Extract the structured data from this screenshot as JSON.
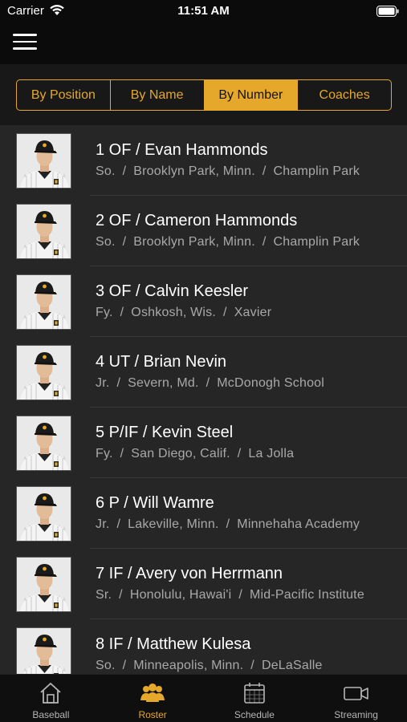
{
  "status_bar": {
    "carrier": "Carrier",
    "time": "11:51 AM"
  },
  "segments": [
    {
      "label": "By Position",
      "active": false
    },
    {
      "label": "By Name",
      "active": false
    },
    {
      "label": "By Number",
      "active": true
    },
    {
      "label": "Coaches",
      "active": false
    }
  ],
  "players": [
    {
      "title": "1 OF / Evan Hammonds",
      "year": "So.",
      "hometown": "Brooklyn Park, Minn.",
      "school": "Champlin Park"
    },
    {
      "title": "2 OF / Cameron Hammonds",
      "year": "So.",
      "hometown": "Brooklyn Park, Minn.",
      "school": "Champlin Park"
    },
    {
      "title": "3 OF / Calvin Keesler",
      "year": "Fy.",
      "hometown": "Oshkosh, Wis.",
      "school": "Xavier"
    },
    {
      "title": "4 UT / Brian Nevin",
      "year": "Jr.",
      "hometown": "Severn, Md.",
      "school": "McDonogh School"
    },
    {
      "title": "5 P/IF / Kevin Steel",
      "year": "Fy.",
      "hometown": "San Diego, Calif.",
      "school": "La Jolla"
    },
    {
      "title": "6 P / Will Wamre",
      "year": "Jr.",
      "hometown": "Lakeville, Minn.",
      "school": "Minnehaha Academy"
    },
    {
      "title": "7 IF / Avery von Herrmann",
      "year": "Sr.",
      "hometown": "Honolulu, Hawai'i",
      "school": "Mid-Pacific Institute"
    },
    {
      "title": "8 IF / Matthew Kulesa",
      "year": "So.",
      "hometown": "Minneapolis, Minn.",
      "school": "DeLaSalle"
    }
  ],
  "separator": "/",
  "tabs": [
    {
      "label": "Baseball",
      "icon": "home-icon",
      "active": false
    },
    {
      "label": "Roster",
      "icon": "people-icon",
      "active": true
    },
    {
      "label": "Schedule",
      "icon": "calendar-icon",
      "active": false
    },
    {
      "label": "Streaming",
      "icon": "video-camera-icon",
      "active": false
    }
  ],
  "colors": {
    "accent": "#e6a82b",
    "background": "#262626",
    "bar": "#0b0b0b"
  }
}
